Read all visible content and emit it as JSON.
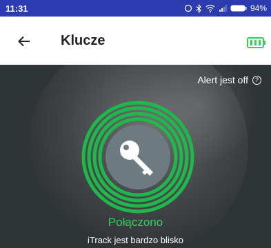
{
  "status_bar": {
    "time": "11:31",
    "battery_percent": "94%"
  },
  "header": {
    "title": "Klucze"
  },
  "device": {
    "alert_text": "Alert jest off",
    "connection_status": "Połączono",
    "proximity_text": "iTrack jest bardzo blisko"
  },
  "colors": {
    "status_bar": "#2d3bb0",
    "accent_green": "#2ed35a",
    "background": "#2f3437"
  },
  "icons": {
    "back": "arrow-left-icon",
    "device_battery": "battery-icon",
    "help": "question-circle-icon",
    "key": "key-icon"
  }
}
